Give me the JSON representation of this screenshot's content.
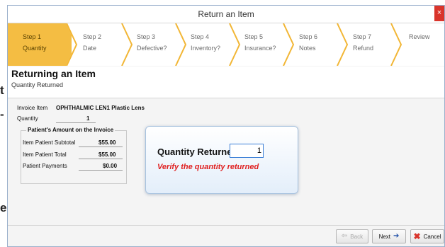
{
  "left_edge_letters": [
    "t",
    "-",
    "e"
  ],
  "window": {
    "title": "Return an Item",
    "close_glyph": "×"
  },
  "steps": [
    {
      "name": "Step 1",
      "label": "Quantity",
      "active": true
    },
    {
      "name": "Step 2",
      "label": "Date"
    },
    {
      "name": "Step 3",
      "label": "Defective?"
    },
    {
      "name": "Step 4",
      "label": "Inventory?"
    },
    {
      "name": "Step 5",
      "label": "Insurance?"
    },
    {
      "name": "Step 6",
      "label": "Notes"
    },
    {
      "name": "Step 7",
      "label": "Refund"
    },
    {
      "name": "Review",
      "label": ""
    }
  ],
  "header": {
    "title": "Returning an Item",
    "subtitle": "Quantity Returned"
  },
  "invoice": {
    "item_label": "Invoice Item",
    "item_value": "OPHTHALMIC LEN1 Plastic Lens",
    "quantity_label": "Quantity",
    "quantity_value": "1"
  },
  "amounts": {
    "legend": "Patient's Amount on the Invoice",
    "rows": [
      {
        "label": "Item Patient Subtotal",
        "value": "$55.00"
      },
      {
        "label": "Item Patient Total",
        "value": "$55.00"
      },
      {
        "label": "Patient Payments",
        "value": "$0.00"
      }
    ]
  },
  "dialog": {
    "label": "Quantity Returned",
    "value": "1",
    "message": "Verify the quantity returned"
  },
  "buttons": {
    "back": "Back",
    "next": "Next",
    "cancel": "Cancel"
  },
  "colors": {
    "active_step": "#f4bd43",
    "chevron": "#f2b635",
    "accent_blue": "#3c7fd6",
    "error_red": "#e02020"
  }
}
